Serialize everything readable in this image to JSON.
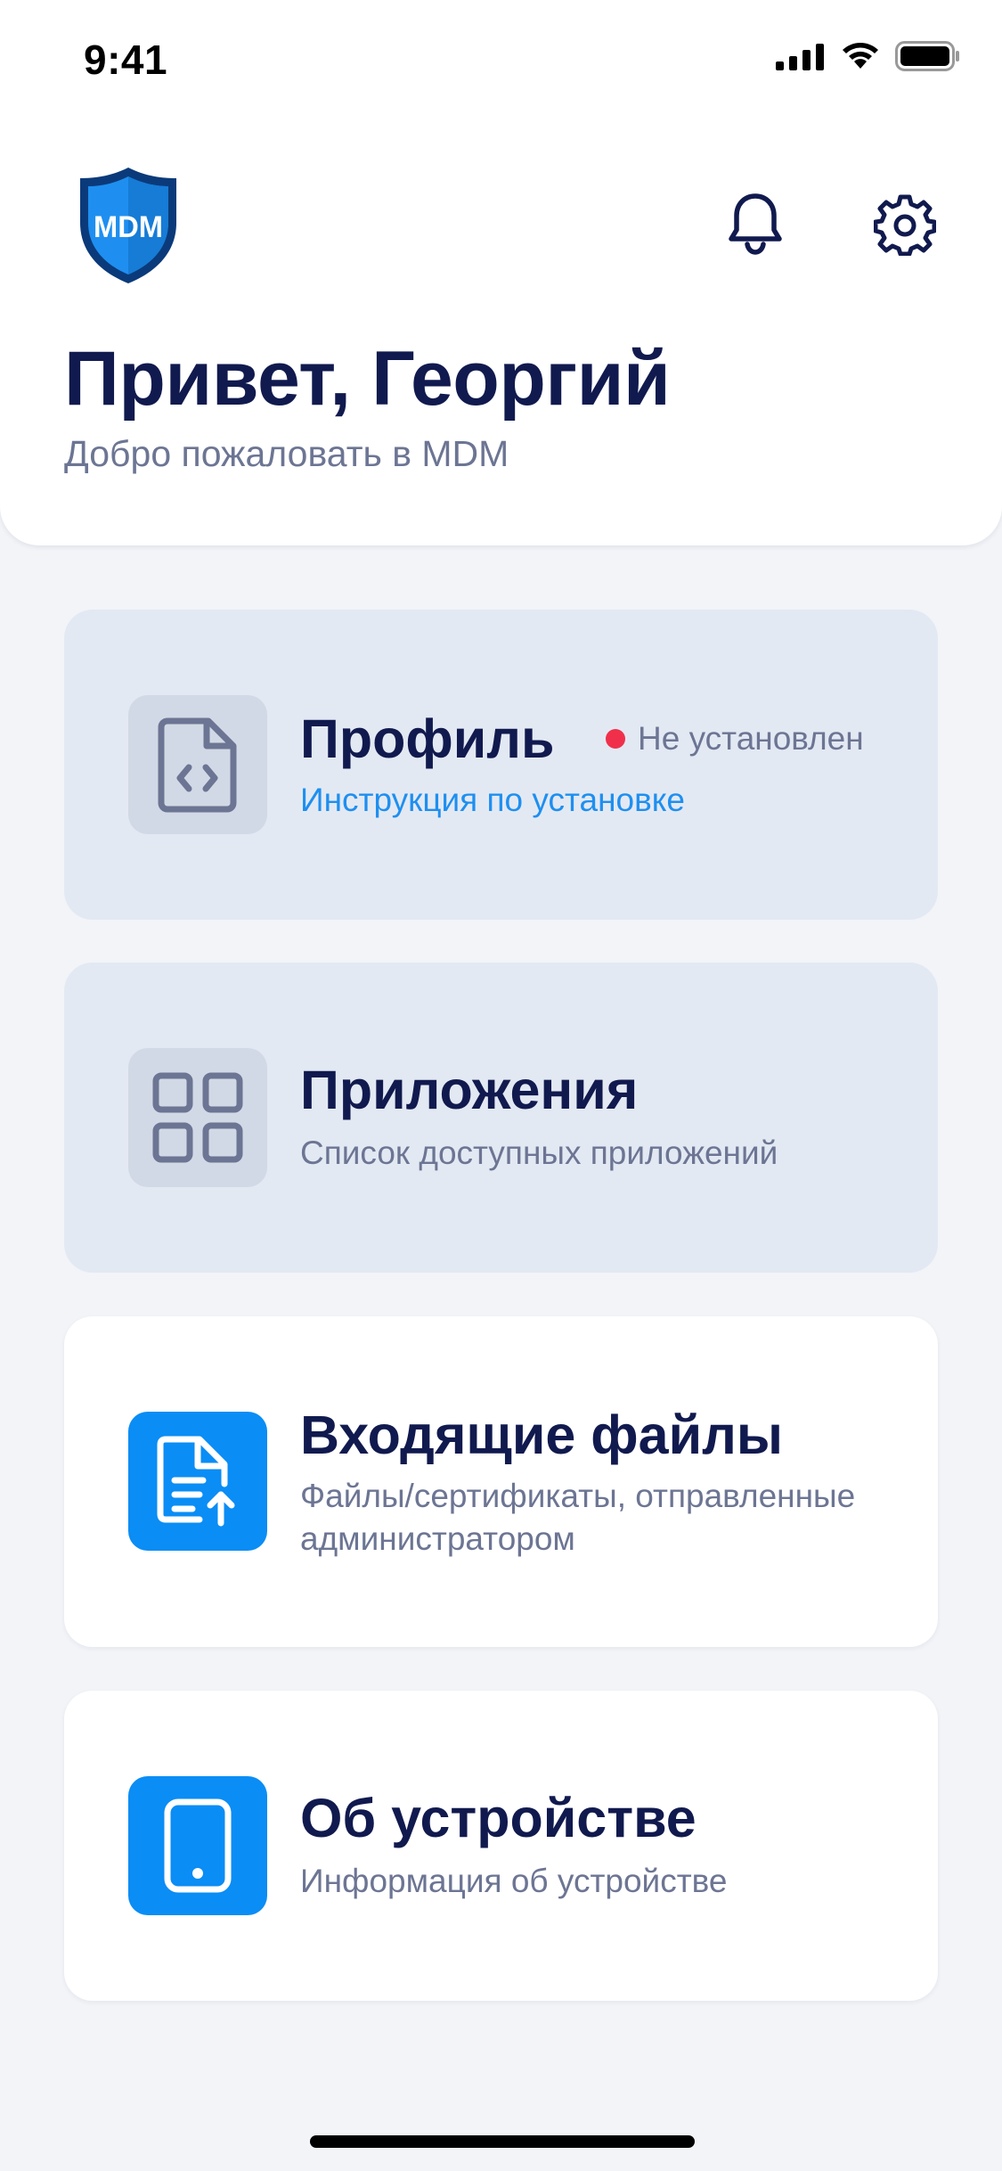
{
  "status_bar": {
    "time": "9:41"
  },
  "header": {
    "logo_icon": "shield-logo-icon",
    "logo_letters": "MDM",
    "greeting": "Привет, Георгий",
    "welcome": "Добро пожаловать в MDM",
    "actions": [
      {
        "icon": "bell-icon"
      },
      {
        "icon": "gear-icon"
      }
    ]
  },
  "cards": {
    "profile": {
      "icon": "file-code-icon",
      "title": "Профиль",
      "status": "Не установлен",
      "status_color": "#F0304A",
      "link": "Инструкция по установке"
    },
    "apps": {
      "icon": "apps-grid-icon",
      "title": "Приложения",
      "subtitle": "Список доступных приложений"
    },
    "files": {
      "icon": "file-upload-icon",
      "title": "Входящие файлы",
      "subtitle": "Файлы/сертификаты, отправленные администратором"
    },
    "device": {
      "icon": "phone-icon",
      "title": "Об устройстве",
      "subtitle": "Информация об устройстве"
    }
  },
  "colors": {
    "primary_text": "#111A4E",
    "secondary_text": "#6C7593",
    "accent": "#0A8DF5",
    "link": "#1E8FF0",
    "muted_card": "#E3E9F3",
    "background": "#F2F4F8"
  }
}
